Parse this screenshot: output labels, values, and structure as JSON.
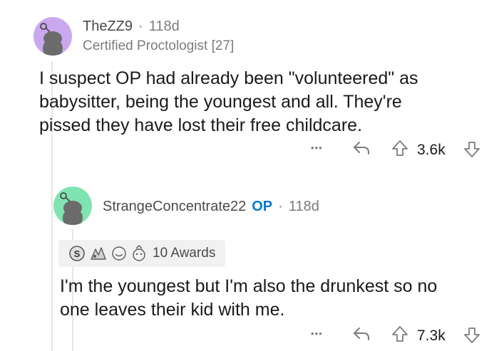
{
  "comment": {
    "username": "TheZZ9",
    "age": "118d",
    "flair": "Certified Proctologist [27]",
    "body_lines": [
      "I suspect OP had already been \"volunteered\" as",
      "babysitter, being the youngest and all. They're",
      "pissed they have lost their free childcare."
    ],
    "score": "3.6k",
    "more": "•••",
    "avatar_color": "#c9a8f0"
  },
  "reply": {
    "username": "StrangeConcentrate22",
    "op_label": "OP",
    "age": "118d",
    "awards_label": "10 Awards",
    "body_lines": [
      "I'm the youngest but I'm also the drunkest so no",
      "one leaves their kid with me."
    ],
    "score": "7.3k",
    "more": "•••",
    "avatar_color": "#7fe3b2"
  },
  "separator": "·",
  "colors": {
    "op_blue": "#0079d3",
    "meta_grey": "#7c7c7c",
    "thread_line": "#e6e6e6"
  }
}
